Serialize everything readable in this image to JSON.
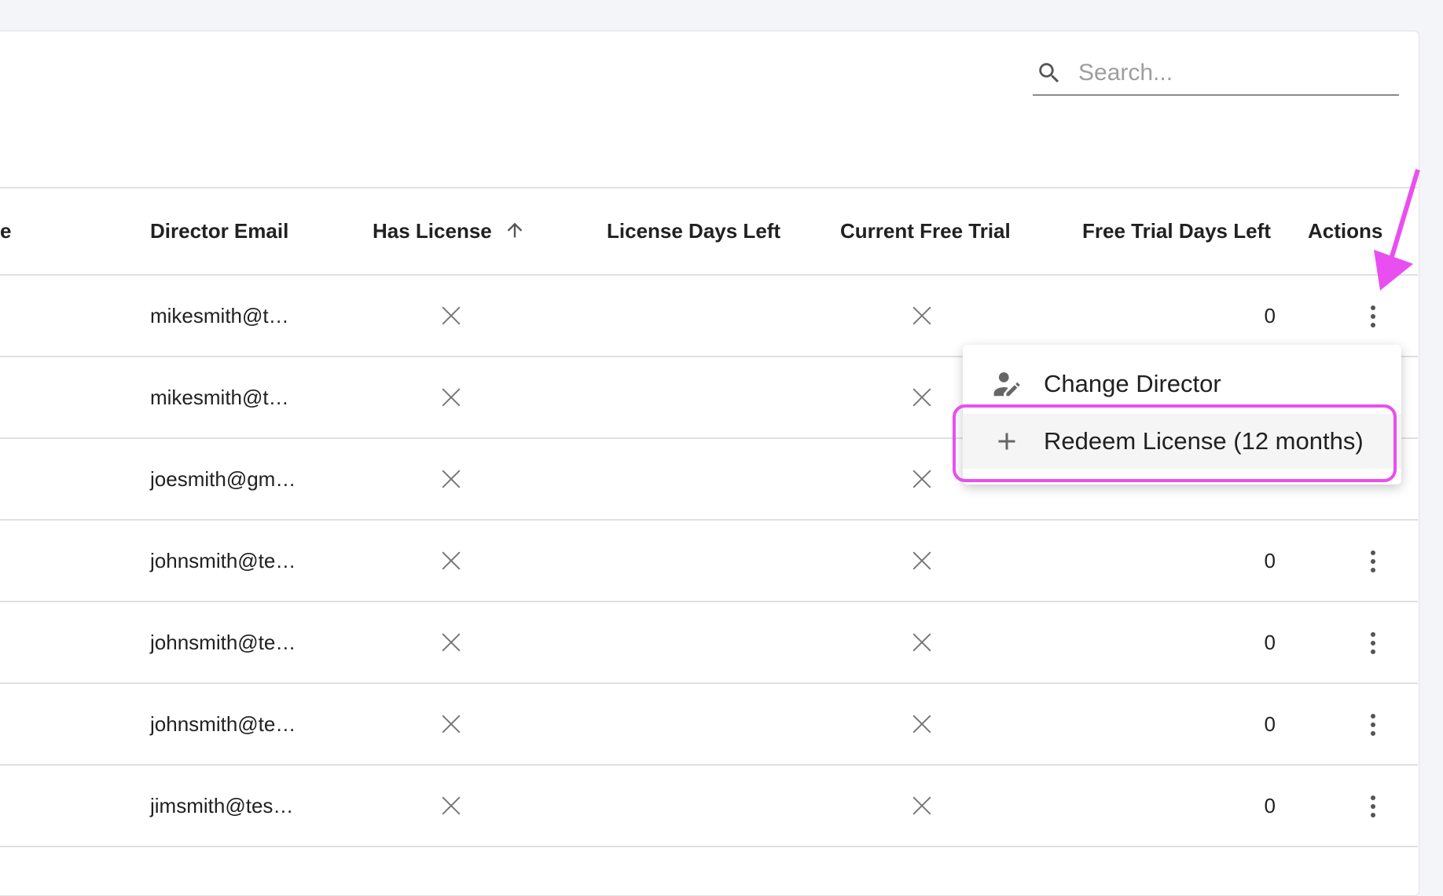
{
  "search": {
    "placeholder": "Search...",
    "icon": "search-icon"
  },
  "table": {
    "columns": [
      "e",
      "Director Email",
      "Has License",
      "License Days Left",
      "Current Free Trial",
      "Free Trial Days Left",
      "Actions"
    ],
    "sort": {
      "column": "Has License",
      "direction": "ascending"
    },
    "rows": [
      {
        "email": "mikesmith@t…",
        "has_license": false,
        "license_days_left": "",
        "current_free_trial": false,
        "free_trial_days_left": "0"
      },
      {
        "email": "mikesmith@t…",
        "has_license": false,
        "license_days_left": "",
        "current_free_trial": false,
        "free_trial_days_left": ""
      },
      {
        "email": "joesmith@gm…",
        "has_license": false,
        "license_days_left": "",
        "current_free_trial": false,
        "free_trial_days_left": ""
      },
      {
        "email": "johnsmith@te…",
        "has_license": false,
        "license_days_left": "",
        "current_free_trial": false,
        "free_trial_days_left": "0"
      },
      {
        "email": "johnsmith@te…",
        "has_license": false,
        "license_days_left": "",
        "current_free_trial": false,
        "free_trial_days_left": "0"
      },
      {
        "email": "johnsmith@te…",
        "has_license": false,
        "license_days_left": "",
        "current_free_trial": false,
        "free_trial_days_left": "0"
      },
      {
        "email": "jimsmith@tes…",
        "has_license": false,
        "license_days_left": "",
        "current_free_trial": false,
        "free_trial_days_left": "0"
      }
    ]
  },
  "menu": {
    "items": [
      {
        "label": "Change Director",
        "icon": "person-edit-icon"
      },
      {
        "label": "Redeem License (12 months)",
        "icon": "plus-icon",
        "highlighted": true
      }
    ]
  },
  "colors": {
    "annotation": "#e94ff0",
    "background": "#f4f5f8",
    "hover": "#f5f5f5"
  }
}
